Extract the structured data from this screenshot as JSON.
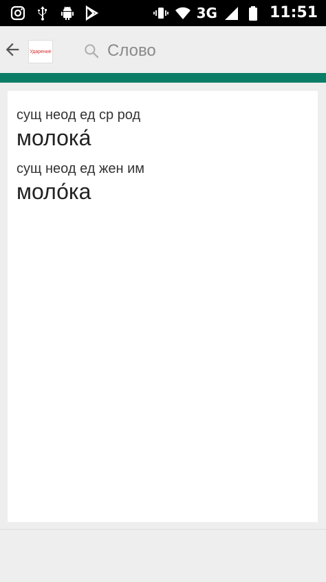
{
  "status_bar": {
    "time": "11:51",
    "network": "3G",
    "left_icons": [
      "instagram-icon",
      "usb-icon",
      "android-icon",
      "play-store-icon"
    ],
    "right_icons": [
      "vibrate-icon",
      "wifi-icon",
      "signal-icon",
      "battery-icon"
    ]
  },
  "app_bar": {
    "logo_text": "Ударение",
    "search_placeholder": "Слово"
  },
  "colors": {
    "accent": "#0b7d67",
    "background": "#eeeeee"
  },
  "entries": [
    {
      "meta": "сущ неод ед ср род",
      "word": "молока́"
    },
    {
      "meta": "сущ неод ед жен им",
      "word": "моло́ка"
    }
  ]
}
